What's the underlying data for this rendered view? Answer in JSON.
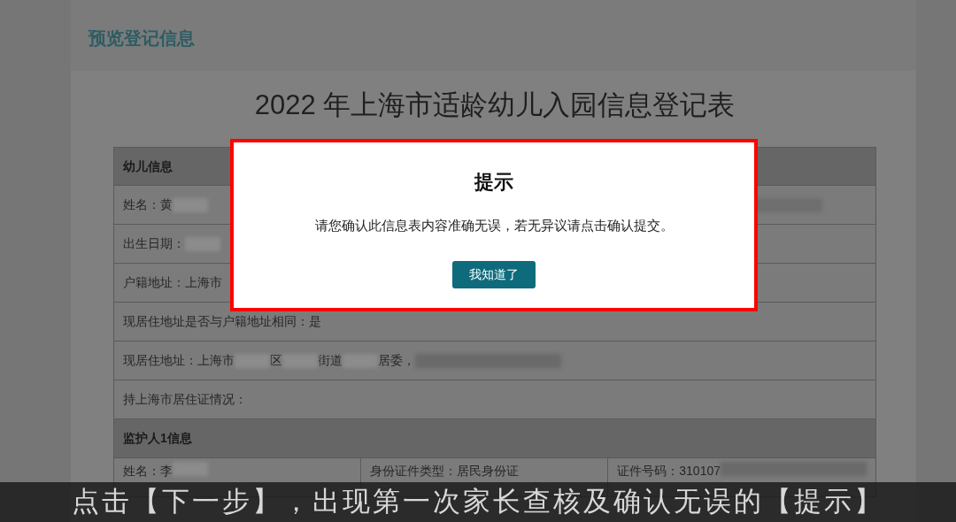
{
  "page_header": {
    "title": "预览登记信息"
  },
  "form": {
    "title": "2022 年上海市适龄幼儿入园信息登记表",
    "rows": [
      {
        "kind": "section",
        "cells": [
          [
            {
              "kind": "text",
              "text": "幼儿信息"
            }
          ]
        ]
      },
      {
        "kind": "field",
        "cells": [
          [
            {
              "kind": "text",
              "text": "姓名：黄"
            },
            {
              "kind": "redacted"
            },
            {
              "kind": "redacted_end"
            }
          ]
        ]
      },
      {
        "kind": "field",
        "cells": [
          [
            {
              "kind": "text",
              "text": "出生日期："
            },
            {
              "kind": "redacted"
            }
          ]
        ]
      },
      {
        "kind": "field",
        "cells": [
          [
            {
              "kind": "text",
              "text": "户籍地址：上海市"
            }
          ]
        ]
      },
      {
        "kind": "field",
        "cells": [
          [
            {
              "kind": "text",
              "text": "现居住地址是否与户籍地址相同：是"
            }
          ]
        ]
      },
      {
        "kind": "field",
        "cells": [
          [
            {
              "kind": "text",
              "text": "现居住地址：上海市"
            },
            {
              "kind": "redacted"
            },
            {
              "kind": "text",
              "text": "区"
            },
            {
              "kind": "redacted"
            },
            {
              "kind": "text",
              "text": "街道"
            },
            {
              "kind": "redacted"
            },
            {
              "kind": "text",
              "text": "居委，"
            },
            {
              "kind": "redacted_long"
            }
          ]
        ]
      },
      {
        "kind": "field",
        "cells": [
          [
            {
              "kind": "text",
              "text": "持上海市居住证情况："
            }
          ]
        ]
      },
      {
        "kind": "section",
        "cells": [
          [
            {
              "kind": "text",
              "text": "监护人1信息"
            }
          ]
        ]
      },
      {
        "kind": "field",
        "cells": [
          [
            {
              "kind": "text",
              "text": "姓名：李"
            },
            {
              "kind": "redacted"
            }
          ],
          [
            {
              "kind": "text",
              "text": "身份证件类型：居民身份证"
            }
          ],
          [
            {
              "kind": "text",
              "text": "证件号码：310107"
            },
            {
              "kind": "redacted_long"
            }
          ]
        ]
      }
    ]
  },
  "dialog": {
    "title": "提示",
    "message": "请您确认此信息表内容准确无误，若无异议请点击确认提交。",
    "button": "我知道了"
  },
  "subtitle": {
    "text": "点击【下一步】，出现第一次家长查核及确认无误的【提示】"
  }
}
